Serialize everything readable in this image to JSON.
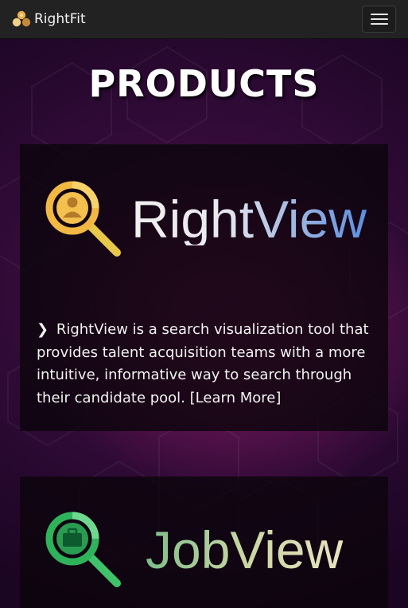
{
  "navbar": {
    "brand_name": "RightFit",
    "brand_icon": "rightfit-logo-icon",
    "menu_icon": "hamburger-menu-icon"
  },
  "page": {
    "title": "PRODUCTS"
  },
  "products": [
    {
      "name": "RightView",
      "icon": "magnifier-person-icon",
      "bullet_icon": "chevron-right-icon",
      "description": "RightView is a search visualization tool that provides talent acquisition teams with a more intuitive, informative way to search through their candidate pool.",
      "link_label": "[Learn More]"
    },
    {
      "name": "JobView",
      "icon": "magnifier-briefcase-icon"
    }
  ],
  "colors": {
    "navbar_bg": "#222222",
    "page_bg_dark": "#2e0a35",
    "page_bg_glow": "#961e6e",
    "card_bg": "#0c050c",
    "rightview_accent": "#f2b843",
    "jobview_accent": "#2fb35a"
  }
}
